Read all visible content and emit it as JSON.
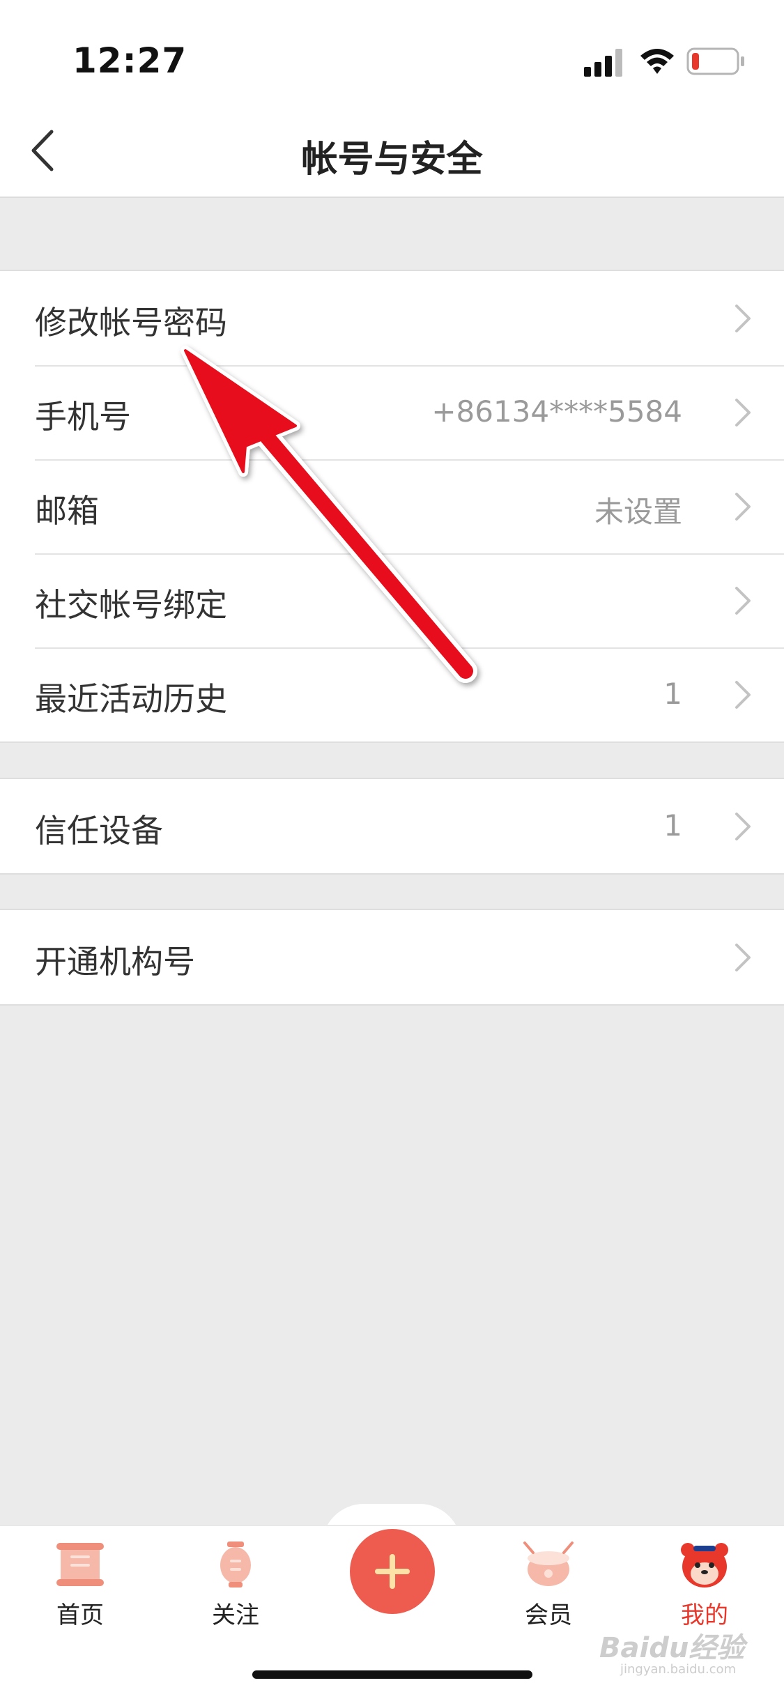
{
  "status": {
    "time": "12:27"
  },
  "nav": {
    "title": "帐号与安全",
    "back_icon": "chevron-left-icon"
  },
  "groups": [
    {
      "rows": [
        {
          "label": "修改帐号密码",
          "value": ""
        },
        {
          "label": "手机号",
          "value": "+86134****5584"
        },
        {
          "label": "邮箱",
          "value": "未设置"
        },
        {
          "label": "社交帐号绑定",
          "value": ""
        },
        {
          "label": "最近活动历史",
          "value": "1"
        }
      ]
    },
    {
      "rows": [
        {
          "label": "信任设备",
          "value": "1"
        }
      ]
    },
    {
      "rows": [
        {
          "label": "开通机构号",
          "value": ""
        }
      ]
    }
  ],
  "tabbar": {
    "tabs": [
      {
        "label": "首页",
        "icon": "scroll-icon"
      },
      {
        "label": "关注",
        "icon": "lantern-icon"
      },
      {
        "label": "",
        "icon": "plus-icon"
      },
      {
        "label": "会员",
        "icon": "drum-icon"
      },
      {
        "label": "我的",
        "icon": "tiger-avatar-icon"
      }
    ],
    "active_color": "#e8382b",
    "add_color": "#ee5b4f"
  },
  "watermark": {
    "text": "Baidu经验",
    "sub": "jingyan.baidu.com"
  },
  "annotation": {
    "arrow_color": "#e8101a"
  }
}
